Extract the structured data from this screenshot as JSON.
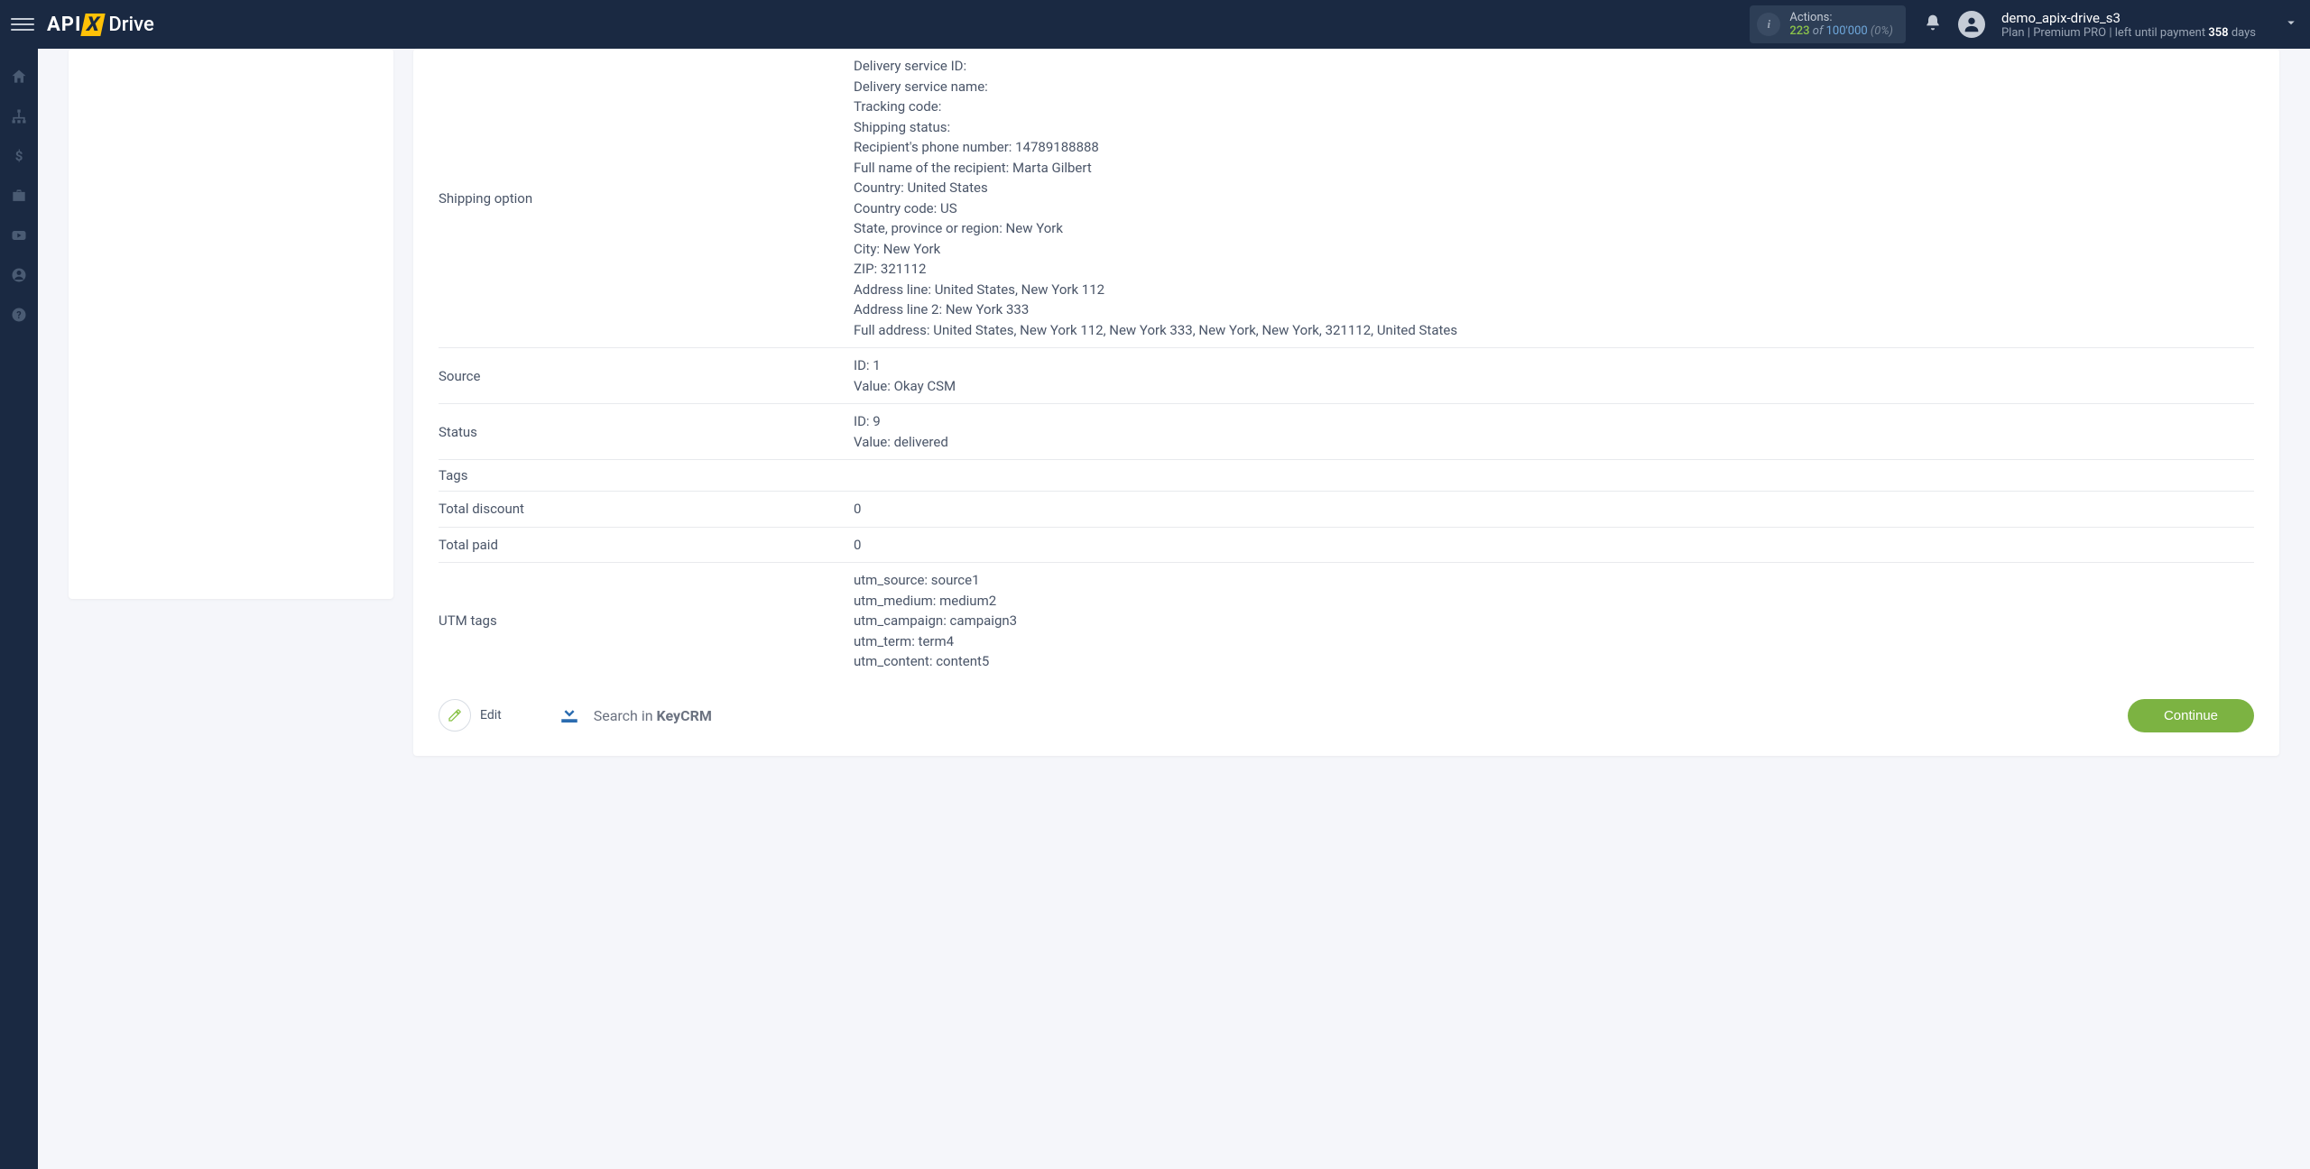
{
  "header": {
    "logo_api": "API",
    "logo_x": "X",
    "logo_drive": "Drive",
    "actions_label": "Actions:",
    "actions_count": "223",
    "actions_of": "of",
    "actions_total": "100'000",
    "actions_pct": "(0%)",
    "user_name": "demo_apix-drive_s3",
    "plan_prefix": "Plan  |",
    "plan_name": "Premium PRO",
    "plan_suffix": "|  left until payment",
    "plan_days": "358",
    "plan_days_suffix": "days"
  },
  "table": {
    "shipping_label": "Shipping option",
    "shipping_lines": [
      "Delivery service ID:",
      "Delivery service name:",
      "Tracking code:",
      "Shipping status:",
      "Recipient's phone number: 14789188888",
      "Full name of the recipient: Marta Gilbert",
      "Country: United States",
      "Country code: US",
      "State, province or region: New York",
      "City: New York",
      "ZIP: 321112",
      "Address line: United States, New York 112",
      "Address line 2: New York 333",
      "Full address: United States, New York 112, New York 333, New York, New York, 321112, United States"
    ],
    "source_label": "Source",
    "source_lines": [
      "ID: 1",
      "Value: Okay CSM"
    ],
    "status_label": "Status",
    "status_lines": [
      "ID: 9",
      "Value: delivered"
    ],
    "tags_label": "Tags",
    "tags_value": "",
    "discount_label": "Total discount",
    "discount_value": "0",
    "paid_label": "Total paid",
    "paid_value": "0",
    "utm_label": "UTM tags",
    "utm_lines": [
      "utm_source: source1",
      "utm_medium: medium2",
      "utm_campaign: campaign3",
      "utm_term: term4",
      "utm_content: content5"
    ]
  },
  "footer": {
    "edit_label": "Edit",
    "search_prefix": "Search in ",
    "search_target": "KeyCRM",
    "continue_label": "Continue"
  }
}
